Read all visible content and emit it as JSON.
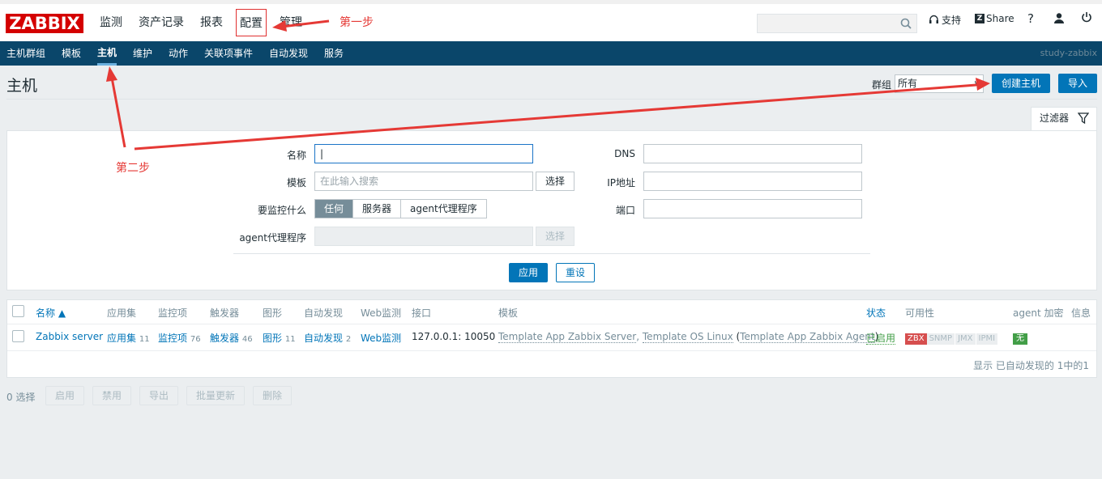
{
  "logo": "ZABBIX",
  "main_menu": [
    {
      "label": "监测"
    },
    {
      "label": "资产记录"
    },
    {
      "label": "报表"
    },
    {
      "label": "配置"
    },
    {
      "label": "管理"
    }
  ],
  "header_right": {
    "support": "支持",
    "share": "Share",
    "help": "?"
  },
  "sub_menu": [
    {
      "label": "主机群组"
    },
    {
      "label": "模板"
    },
    {
      "label": "主机"
    },
    {
      "label": "维护"
    },
    {
      "label": "动作"
    },
    {
      "label": "关联项事件"
    },
    {
      "label": "自动发现"
    },
    {
      "label": "服务"
    }
  ],
  "server_name": "study-zabbix",
  "page": {
    "title": "主机",
    "group_label": "群组",
    "group_value": "所有",
    "create_host": "创建主机",
    "import": "导入"
  },
  "filter": {
    "tab": "过滤器",
    "name_label": "名称",
    "name_value": "|",
    "template_label": "模板",
    "template_placeholder": "在此输入搜索",
    "select_btn": "选择",
    "monitored_by_label": "要监控什么",
    "monitored_by": [
      "任何",
      "服务器",
      "agent代理程序"
    ],
    "proxy_label": "agent代理程序",
    "proxy_select": "选择",
    "dns_label": "DNS",
    "ip_label": "IP地址",
    "port_label": "端口",
    "apply": "应用",
    "reset": "重设"
  },
  "table": {
    "headers": {
      "name": "名称 ▲",
      "apps": "应用集",
      "items": "监控项",
      "triggers": "触发器",
      "graphs": "图形",
      "discovery": "自动发现",
      "web": "Web监测",
      "interface": "接口",
      "templates": "模板",
      "status": "状态",
      "availability": "可用性",
      "encryption": "agent 加密",
      "info": "信息"
    },
    "row": {
      "name": "Zabbix server",
      "apps": "应用集",
      "apps_count": "11",
      "items": "监控项",
      "items_count": "76",
      "triggers": "触发器",
      "triggers_count": "46",
      "graphs": "图形",
      "graphs_count": "11",
      "discovery": "自动发现",
      "discovery_count": "2",
      "web": "Web监测",
      "interface": "127.0.0.1: 10050",
      "tpl1": "Template App Zabbix Server",
      "tpl2": "Template OS Linux",
      "tpl3": "Template App Zabbix Agent",
      "status": "已启用",
      "zbx": "ZBX",
      "snmp": "SNMP",
      "jmx": "JMX",
      "ipmi": "IPMI",
      "encryption": "无"
    },
    "footer": "显示 已自动发现的 1中的1"
  },
  "actions": {
    "selected": "0 选择",
    "enable": "启用",
    "disable": "禁用",
    "export": "导出",
    "mass_update": "批量更新",
    "delete": "删除"
  },
  "annotations": {
    "step1": "第一步",
    "step2": "第二步"
  },
  "colors": {
    "logo": "#d40000",
    "submenu": "#0a466a",
    "primary": "#0275b8",
    "annotation": "#e53935",
    "enabled": "#429e47",
    "zbx_badge": "#d64e4e"
  }
}
